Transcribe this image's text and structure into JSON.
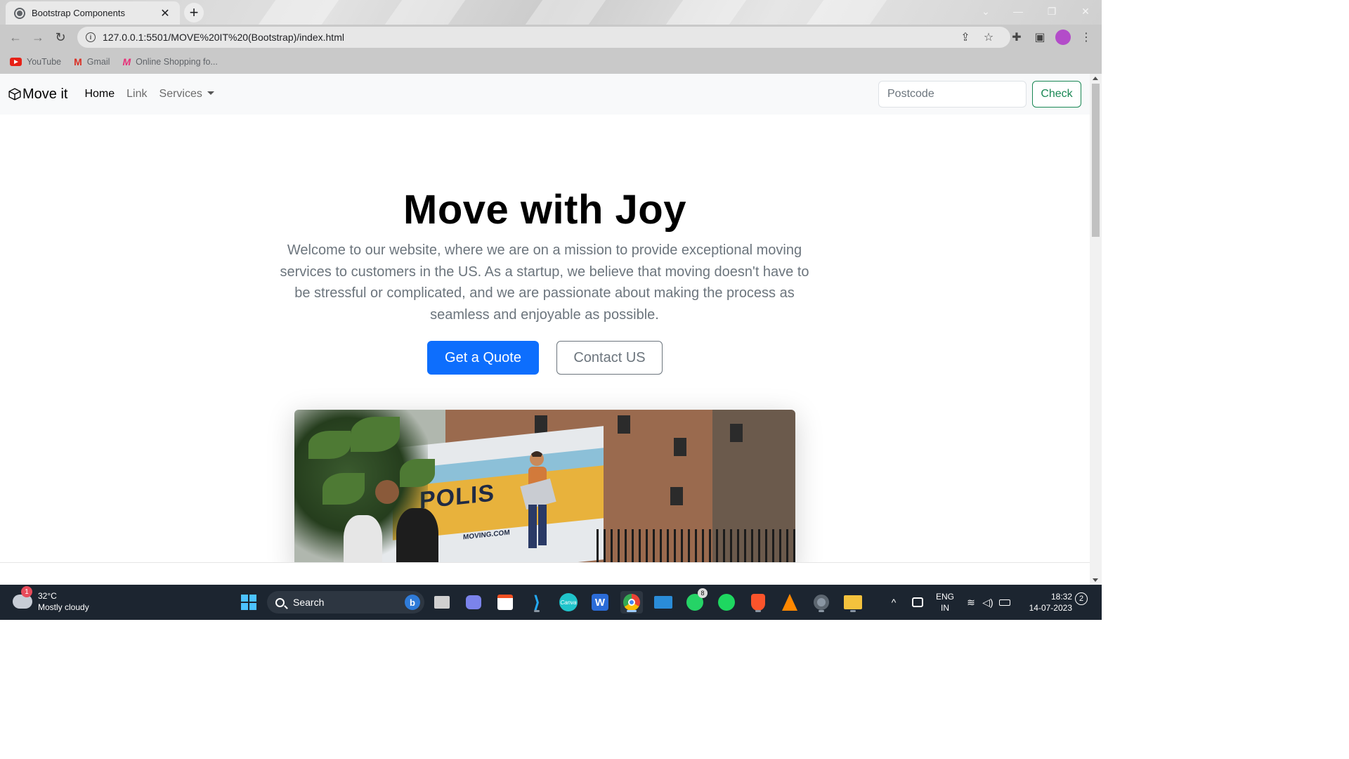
{
  "browser": {
    "tab_title": "Bootstrap Components",
    "tab_close": "✕",
    "new_tab": "+",
    "url": "127.0.0.1:5501/MOVE%20IT%20(Bootstrap)/index.html",
    "bookmarks": [
      {
        "label": "YouTube",
        "icon": "youtube-icon"
      },
      {
        "label": "Gmail",
        "icon": "gmail-icon"
      },
      {
        "label": "Online Shopping fo...",
        "icon": "myntra-icon"
      }
    ]
  },
  "navbar": {
    "brand": "Move it",
    "links": {
      "home": "Home",
      "link": "Link",
      "services": "Services"
    },
    "postcode_placeholder": "Postcode",
    "check_label": "Check"
  },
  "hero": {
    "title": "Move with Joy",
    "text": "Welcome to our website, where we are on a mission to provide exceptional moving services to customers in the US. As a startup, we believe that moving doesn't have to be stressful or complicated, and we are passionate about making the process as seamless and enjoyable as possible.",
    "primary_button": "Get a Quote",
    "secondary_button": "Contact US",
    "image_text": {
      "brand": "POLIS",
      "url": "MOVING.COM"
    }
  },
  "taskbar": {
    "weather_temp": "32°C",
    "weather_desc": "Mostly cloudy",
    "weather_badge": "1",
    "search_label": "Search",
    "whatsapp_badge": "8",
    "language_1": "ENG",
    "language_2": "IN",
    "time": "18:32",
    "date": "14-07-2023",
    "notification_count": "2"
  },
  "colors": {
    "primary": "#0d6efd",
    "success": "#198754",
    "secondary": "#6c757d",
    "navbar_bg": "#f8f9fa",
    "taskbar_bg": "#1c2530"
  }
}
